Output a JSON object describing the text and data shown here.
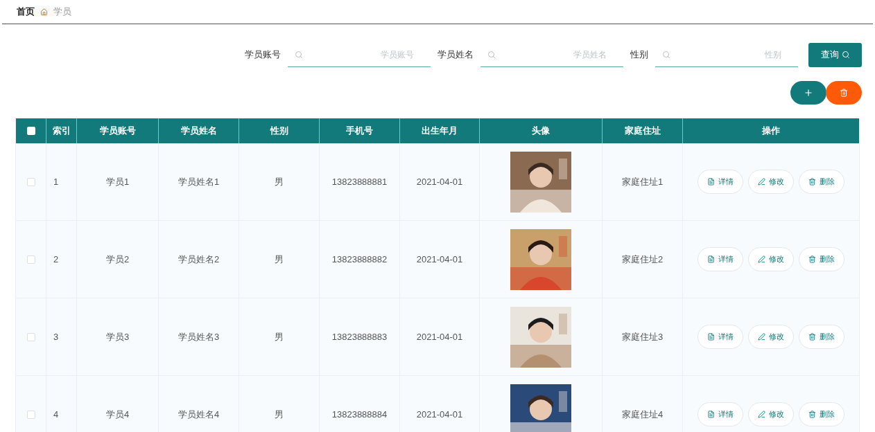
{
  "breadcrumb": {
    "home": "首页",
    "current": "学员"
  },
  "search": {
    "fields": [
      {
        "label": "学员账号",
        "placeholder": "学员账号"
      },
      {
        "label": "学员姓名",
        "placeholder": "学员姓名"
      },
      {
        "label": "性别",
        "placeholder": "性别"
      }
    ],
    "button": "查询"
  },
  "table": {
    "select_all": {
      "checked": false
    },
    "columns": [
      "索引",
      "学员账号",
      "学员姓名",
      "性别",
      "手机号",
      "出生年月",
      "头像",
      "家庭住址",
      "操作"
    ],
    "rows": [
      {
        "checked": false,
        "cells": [
          "1",
          "学员1",
          "学员姓名1",
          "男",
          "13823888881",
          "2021-04-01",
          "家庭住址1"
        ],
        "actions": [
          {
            "kind": "detail",
            "label": "详情"
          },
          {
            "kind": "edit",
            "label": "修改"
          },
          {
            "kind": "delete",
            "label": "删除"
          }
        ]
      },
      {
        "checked": false,
        "cells": [
          "2",
          "学员2",
          "学员姓名2",
          "男",
          "13823888882",
          "2021-04-01",
          "家庭住址2"
        ],
        "actions": [
          {
            "kind": "detail",
            "label": "详情"
          },
          {
            "kind": "edit",
            "label": "修改"
          },
          {
            "kind": "delete",
            "label": "删除"
          }
        ]
      },
      {
        "checked": false,
        "cells": [
          "3",
          "学员3",
          "学员姓名3",
          "男",
          "13823888883",
          "2021-04-01",
          "家庭住址3"
        ],
        "actions": [
          {
            "kind": "detail",
            "label": "详情"
          },
          {
            "kind": "edit",
            "label": "修改"
          },
          {
            "kind": "delete",
            "label": "删除"
          }
        ]
      },
      {
        "checked": false,
        "cells": [
          "4",
          "学员4",
          "学员姓名4",
          "男",
          "13823888884",
          "2021-04-01",
          "家庭住址4"
        ],
        "actions": [
          {
            "kind": "detail",
            "label": "详情"
          },
          {
            "kind": "edit",
            "label": "修改"
          },
          {
            "kind": "delete",
            "label": "删除"
          }
        ]
      }
    ]
  }
}
